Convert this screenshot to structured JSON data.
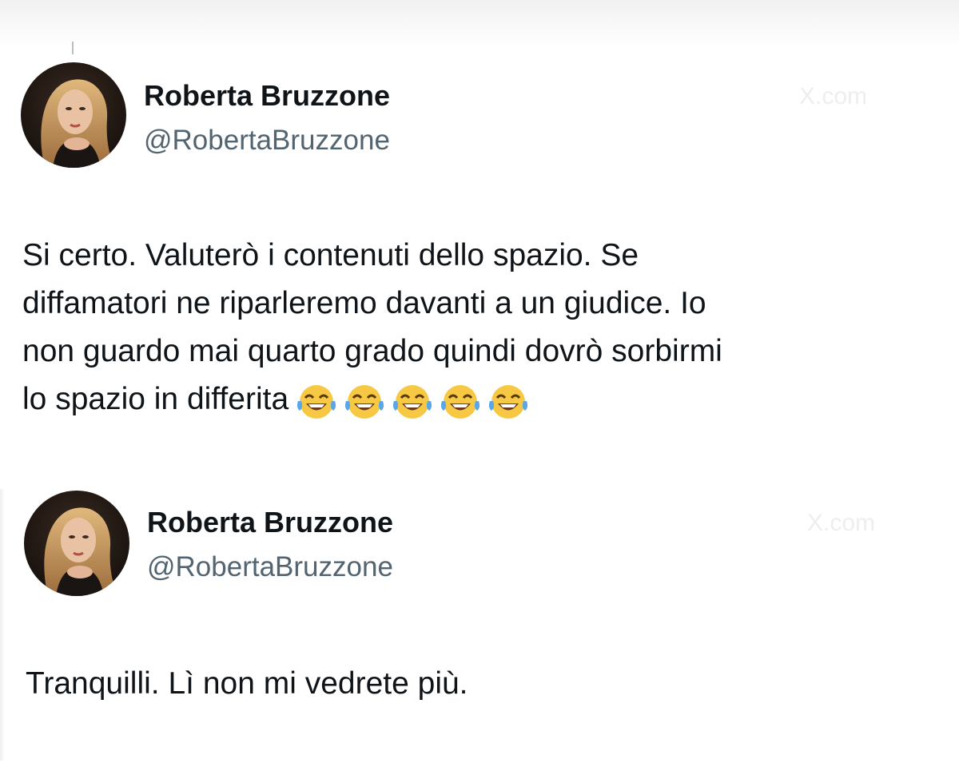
{
  "tweets": [
    {
      "display_name": "Roberta Bruzzone",
      "handle": "@RobertaBruzzone",
      "text": "Si certo. Valuterò i contenuti dello spazio. Se\ndiffamatori ne riparleremo davanti a un giudice. Io\nnon guardo mai quarto grado quindi dovrò sorbirmi\nlo spazio in differita",
      "emojis": [
        "face-with-tears-of-joy-icon",
        "face-with-tears-of-joy-icon",
        "face-with-tears-of-joy-icon",
        "face-with-tears-of-joy-icon",
        "face-with-tears-of-joy-icon"
      ],
      "watermark": "X.com"
    },
    {
      "display_name": "Roberta Bruzzone",
      "handle": "@RobertaBruzzone",
      "text": "Tranquilli. Lì non mi vedrete più.",
      "watermark": "X.com"
    }
  ],
  "colors": {
    "text_primary": "#0f1419",
    "text_secondary": "#536471",
    "background": "#ffffff"
  }
}
